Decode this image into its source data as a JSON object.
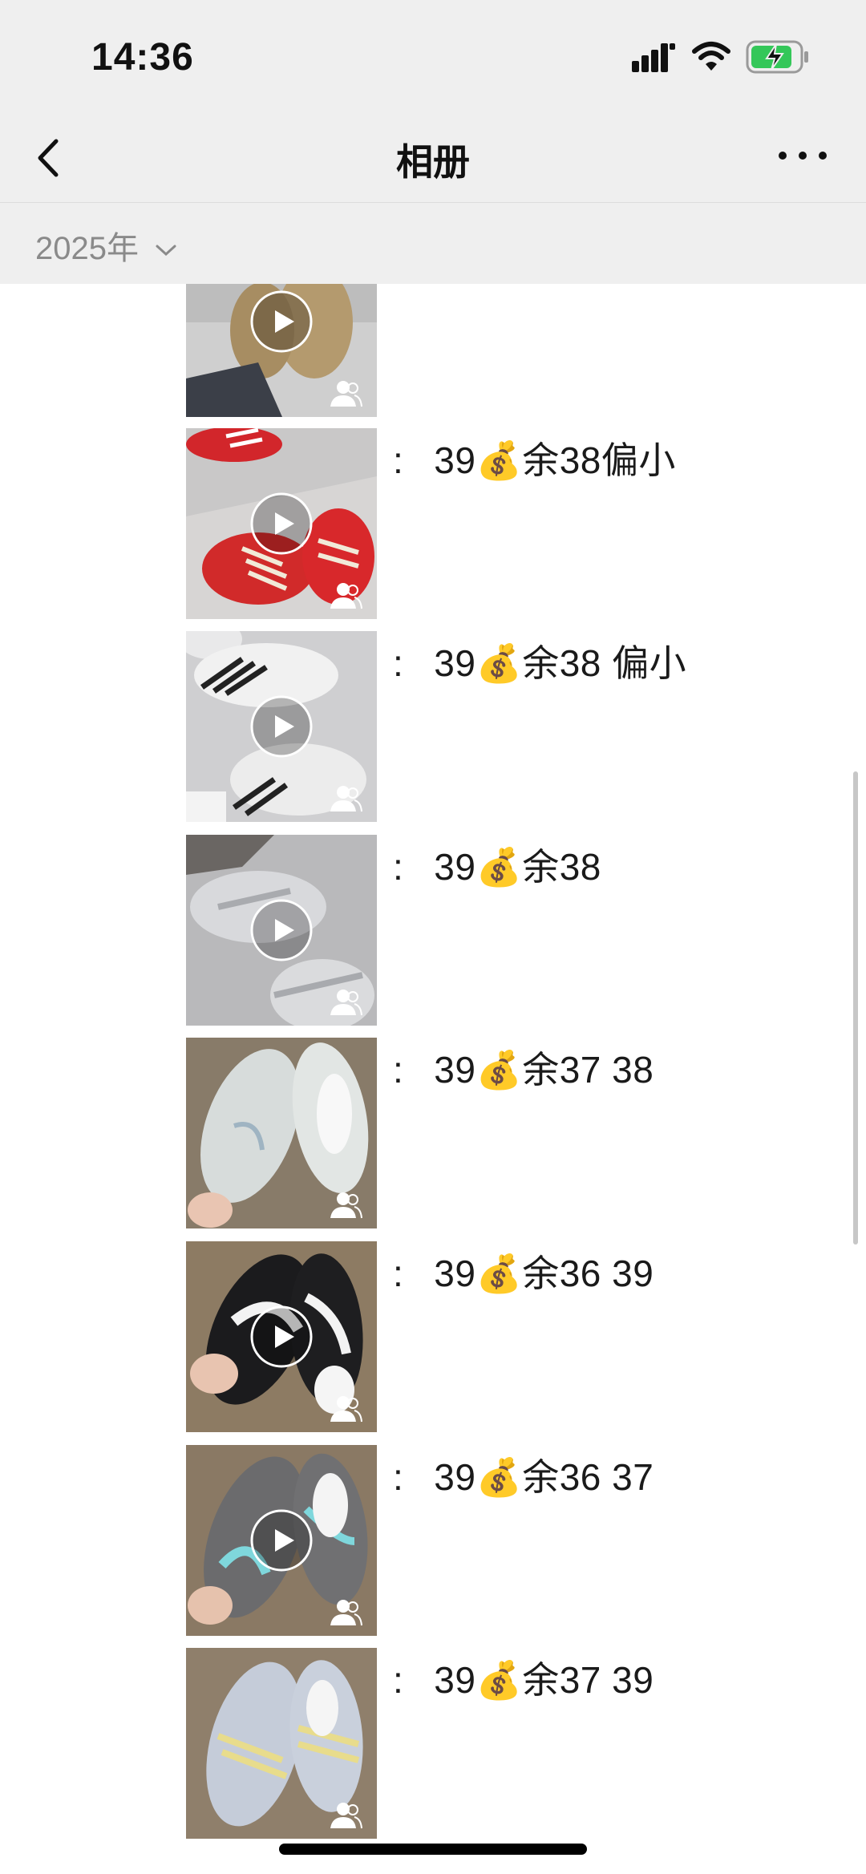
{
  "status": {
    "time": "14:36"
  },
  "nav": {
    "title": "相册"
  },
  "year_filter": {
    "label": "2025年"
  },
  "colors": {
    "header_bg": "#efefef",
    "battery_fill": "#34c759"
  },
  "posts": [
    {
      "thumbnail": "tan-suede-shoes-thumbnail",
      "has_video": true,
      "caption": ""
    },
    {
      "thumbnail": "red-sneakers-thumbnail",
      "has_video": true,
      "caption": "39💰余38偏小"
    },
    {
      "thumbnail": "white-black-stripe-sneakers-thumbnail",
      "has_video": true,
      "caption": "39💰余38 偏小"
    },
    {
      "thumbnail": "silver-sneakers-thumbnail",
      "has_video": true,
      "caption": "39💰余38"
    },
    {
      "thumbnail": "grey-silver-sneakers-thumbnail",
      "has_video": false,
      "caption": "39💰余37 38"
    },
    {
      "thumbnail": "black-white-sneakers-thumbnail",
      "has_video": true,
      "caption": "39💰余36 39"
    },
    {
      "thumbnail": "grey-teal-sneakers-thumbnail",
      "has_video": true,
      "caption": "39💰余36 37"
    },
    {
      "thumbnail": "light-blue-yellow-sneakers-thumbnail",
      "has_video": false,
      "caption": "39💰余37 39"
    }
  ]
}
